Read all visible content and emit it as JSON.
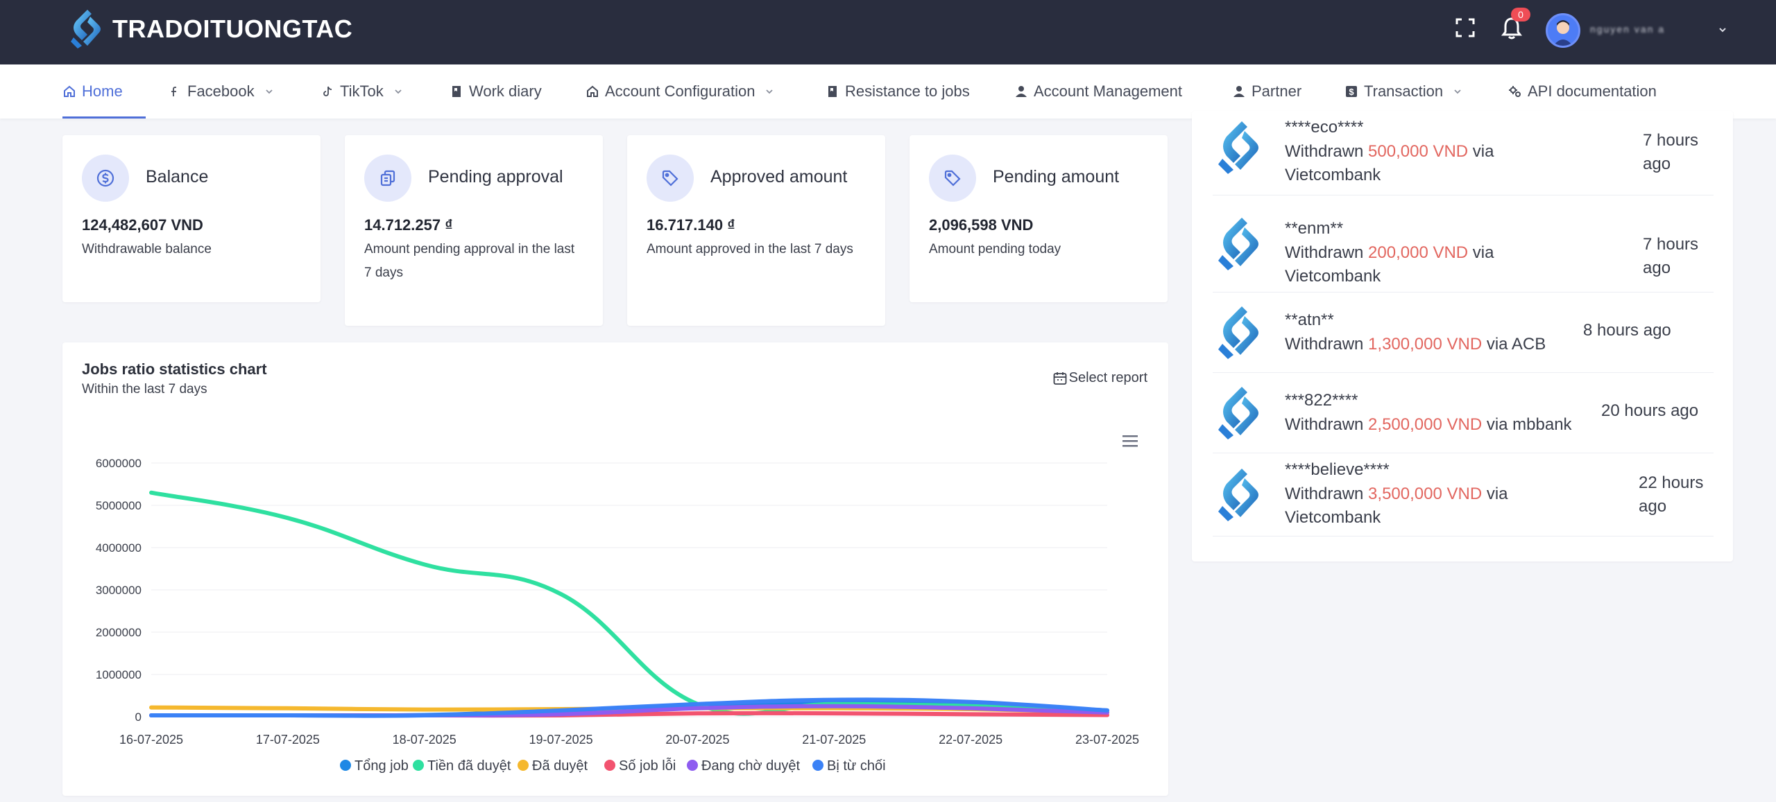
{
  "header": {
    "brand": "TRADOITUONGTAC",
    "notification_count": "0",
    "user_name": "nguyen van a"
  },
  "nav": [
    {
      "label": "Home",
      "icon": "home-icon",
      "active": true
    },
    {
      "label": "Facebook",
      "icon": "facebook-icon",
      "dropdown": true
    },
    {
      "label": "TikTok",
      "icon": "tiktok-icon",
      "dropdown": true
    },
    {
      "label": "Work diary",
      "icon": "book-icon"
    },
    {
      "label": "Account Configuration",
      "icon": "home-icon",
      "dropdown": true
    },
    {
      "label": "Resistance to jobs",
      "icon": "book-icon"
    },
    {
      "label": "Account Management",
      "icon": "user-icon"
    },
    {
      "label": "Partner",
      "icon": "user-icon"
    },
    {
      "label": "Transaction",
      "icon": "dollar-square-icon",
      "dropdown": true
    },
    {
      "label": "API documentation",
      "icon": "gears-icon"
    }
  ],
  "stats": [
    {
      "title": "Balance",
      "value": "124,482,607 VND",
      "desc": "Withdrawable balance",
      "icon": "dollar-circle-icon"
    },
    {
      "title": "Pending approval",
      "value": "14.712.257 ₫",
      "desc": "Amount pending approval in the last 7 days",
      "icon": "copy-icon"
    },
    {
      "title": "Approved amount",
      "value": "16.717.140 ₫",
      "desc": "Amount approved in the last 7 days",
      "icon": "tag-icon"
    },
    {
      "title": "Pending amount",
      "value": "2,096,598 VND",
      "desc": "Amount pending today",
      "icon": "tag-icon"
    }
  ],
  "chart": {
    "title": "Jobs ratio statistics chart",
    "subtitle": "Within the last 7 days",
    "select_report": "Select report"
  },
  "chart_data": {
    "type": "line",
    "x": [
      "16-07-2025",
      "17-07-2025",
      "18-07-2025",
      "19-07-2025",
      "20-07-2025",
      "21-07-2025",
      "22-07-2025",
      "23-07-2025"
    ],
    "y_ticks": [
      "0",
      "1000000",
      "2000000",
      "3000000",
      "4000000",
      "5000000",
      "6000000"
    ],
    "ylim": [
      0,
      6000000
    ],
    "grid": true,
    "legend_position": "bottom",
    "series": [
      {
        "name": "Tổng job",
        "color": "#1e88e5",
        "values": [
          30000,
          30000,
          40000,
          150000,
          250000,
          350000,
          300000,
          150000
        ]
      },
      {
        "name": "Tiền đã duyệt",
        "color": "#2fe0a0",
        "values": [
          5300000,
          4700000,
          3600000,
          2900000,
          300000,
          300000,
          250000,
          100000
        ]
      },
      {
        "name": "Đã duyệt",
        "color": "#f5b82e",
        "values": [
          220000,
          200000,
          170000,
          180000,
          200000,
          200000,
          180000,
          100000
        ]
      },
      {
        "name": "Số job lỗi",
        "color": "#f2536f",
        "values": [
          0,
          0,
          0,
          20000,
          80000,
          80000,
          60000,
          40000
        ]
      },
      {
        "name": "Đang chờ duyệt",
        "color": "#8e5cf0",
        "values": [
          0,
          0,
          0,
          60000,
          200000,
          250000,
          200000,
          100000
        ]
      },
      {
        "name": "Bị từ chối",
        "color": "#3b82f6",
        "values": [
          10000,
          10000,
          20000,
          150000,
          300000,
          400000,
          350000,
          150000
        ]
      }
    ]
  },
  "withdrawals": [
    {
      "user": "****eco****",
      "prefix": "Withdrawn ",
      "amount": "500,000 VND",
      "suffix": " via Vietcombank",
      "time": "7 hours ago"
    },
    {
      "user": "**enm**",
      "prefix": "Withdrawn ",
      "amount": "200,000 VND",
      "suffix": " via Vietcombank",
      "time": "7 hours ago"
    },
    {
      "user": "**atn**",
      "prefix": "Withdrawn ",
      "amount": "1,300,000 VND",
      "suffix": " via ACB",
      "time": "8 hours ago"
    },
    {
      "user": "***822****",
      "prefix": "Withdrawn ",
      "amount": "2,500,000 VND",
      "suffix": " via mbbank",
      "time": "20 hours ago"
    },
    {
      "user": "****believe****",
      "prefix": "Withdrawn ",
      "amount": "3,500,000 VND",
      "suffix": " via Vietcombank",
      "time": "22 hours ago"
    }
  ],
  "colors": {
    "topbar": "#292d3e",
    "accent": "#4f6fd8",
    "amount": "#e2665f"
  }
}
